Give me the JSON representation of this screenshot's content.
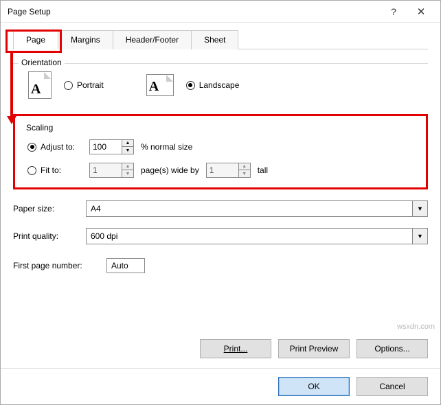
{
  "title": "Page Setup",
  "tabs": [
    "Page",
    "Margins",
    "Header/Footer",
    "Sheet"
  ],
  "active_tab_index": 0,
  "orientation": {
    "legend": "Orientation",
    "portrait_label": "Portrait",
    "landscape_label": "Landscape",
    "selected": "landscape"
  },
  "scaling": {
    "legend": "Scaling",
    "adjust_label": "Adjust to:",
    "adjust_value": "100",
    "adjust_suffix": "% normal size",
    "fit_label": "Fit to:",
    "fit_wide": "1",
    "fit_mid": "page(s) wide by",
    "fit_tall": "1",
    "fit_suffix": "tall",
    "selected": "adjust"
  },
  "paper_size": {
    "label": "Paper size:",
    "value": "A4"
  },
  "print_quality": {
    "label": "Print quality:",
    "value": "600 dpi"
  },
  "first_page": {
    "label": "First page number:",
    "value": "Auto"
  },
  "buttons": {
    "print": "Print...",
    "preview": "Print Preview",
    "options": "Options...",
    "ok": "OK",
    "cancel": "Cancel"
  },
  "watermark": "wsxdn.com"
}
